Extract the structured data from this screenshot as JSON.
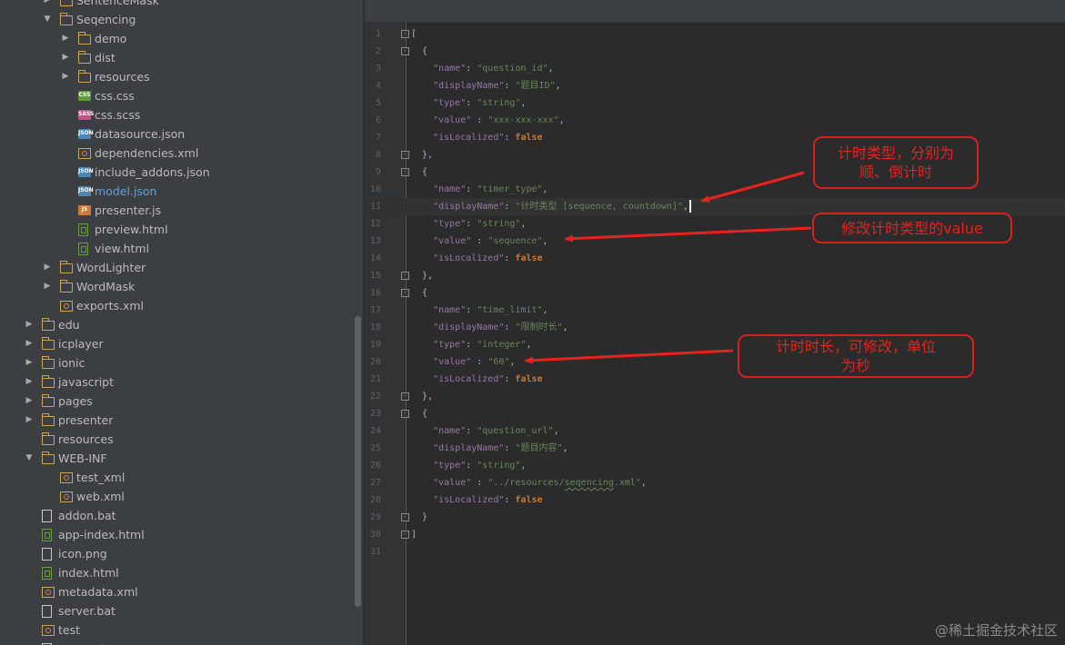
{
  "project_tree": {
    "items": [
      {
        "depth": 2,
        "expand": "right",
        "icon": "folder",
        "label": "SentenceMask"
      },
      {
        "depth": 2,
        "expand": "down",
        "icon": "folder",
        "label": "Seqencing"
      },
      {
        "depth": 3,
        "expand": "right",
        "icon": "folder",
        "label": "demo"
      },
      {
        "depth": 3,
        "expand": "right",
        "icon": "folder",
        "label": "dist"
      },
      {
        "depth": 3,
        "expand": "right",
        "icon": "folder",
        "label": "resources"
      },
      {
        "depth": 3,
        "expand": "none",
        "icon": "css",
        "label": "css.css"
      },
      {
        "depth": 3,
        "expand": "none",
        "icon": "scss",
        "label": "css.scss"
      },
      {
        "depth": 3,
        "expand": "none",
        "icon": "json",
        "label": "datasource.json"
      },
      {
        "depth": 3,
        "expand": "none",
        "icon": "xml",
        "label": "dependencies.xml"
      },
      {
        "depth": 3,
        "expand": "none",
        "icon": "json",
        "label": "include_addons.json"
      },
      {
        "depth": 3,
        "expand": "none",
        "icon": "json",
        "label": "model.json",
        "selected": true
      },
      {
        "depth": 3,
        "expand": "none",
        "icon": "js",
        "label": "presenter.js"
      },
      {
        "depth": 3,
        "expand": "none",
        "icon": "html",
        "label": "preview.html"
      },
      {
        "depth": 3,
        "expand": "none",
        "icon": "html",
        "label": "view.html"
      },
      {
        "depth": 2,
        "expand": "right",
        "icon": "folder",
        "label": "WordLighter"
      },
      {
        "depth": 2,
        "expand": "right",
        "icon": "folder",
        "label": "WordMask"
      },
      {
        "depth": 2,
        "expand": "none",
        "icon": "xml",
        "label": "exports.xml"
      },
      {
        "depth": 1,
        "expand": "right",
        "icon": "folder",
        "label": "edu"
      },
      {
        "depth": 1,
        "expand": "right",
        "icon": "folder",
        "label": "icplayer"
      },
      {
        "depth": 1,
        "expand": "right",
        "icon": "folder",
        "label": "ionic"
      },
      {
        "depth": 1,
        "expand": "right",
        "icon": "folder",
        "label": "javascript"
      },
      {
        "depth": 1,
        "expand": "right",
        "icon": "folder",
        "label": "pages"
      },
      {
        "depth": 1,
        "expand": "right",
        "icon": "folder",
        "label": "presenter"
      },
      {
        "depth": 1,
        "expand": "none",
        "icon": "folder",
        "label": "resources"
      },
      {
        "depth": 1,
        "expand": "down",
        "icon": "folder",
        "label": "WEB-INF"
      },
      {
        "depth": 2,
        "expand": "none",
        "icon": "xml",
        "label": "test_xml"
      },
      {
        "depth": 2,
        "expand": "none",
        "icon": "xml",
        "label": "web.xml"
      },
      {
        "depth": 1,
        "expand": "none",
        "icon": "file",
        "label": "addon.bat"
      },
      {
        "depth": 1,
        "expand": "none",
        "icon": "html",
        "label": "app-index.html"
      },
      {
        "depth": 1,
        "expand": "none",
        "icon": "file",
        "label": "icon.png"
      },
      {
        "depth": 1,
        "expand": "none",
        "icon": "html",
        "label": "index.html"
      },
      {
        "depth": 1,
        "expand": "none",
        "icon": "xml",
        "label": "metadata.xml"
      },
      {
        "depth": 1,
        "expand": "none",
        "icon": "file",
        "label": "server.bat"
      },
      {
        "depth": 1,
        "expand": "none",
        "icon": "xml",
        "label": "test"
      },
      {
        "depth": 1,
        "expand": "none",
        "icon": "file",
        "label": "test.xml"
      }
    ]
  },
  "editor": {
    "current_line": 11,
    "lines": [
      {
        "n": "1",
        "fold": "-",
        "tokens": [
          [
            "p",
            "["
          ]
        ]
      },
      {
        "n": "2",
        "fold": "-",
        "tokens": [
          [
            "p",
            "  {"
          ]
        ]
      },
      {
        "n": "3",
        "tokens": [
          [
            "p",
            "    "
          ],
          [
            "k",
            "\"name\""
          ],
          [
            "p",
            ": "
          ],
          [
            "s",
            "\"question_id\""
          ],
          [
            "p",
            ","
          ]
        ]
      },
      {
        "n": "4",
        "tokens": [
          [
            "p",
            "    "
          ],
          [
            "k",
            "\"displayName\""
          ],
          [
            "p",
            ": "
          ],
          [
            "s",
            "\"题目ID\""
          ],
          [
            "p",
            ","
          ]
        ]
      },
      {
        "n": "5",
        "tokens": [
          [
            "p",
            "    "
          ],
          [
            "k",
            "\"type\""
          ],
          [
            "p",
            ": "
          ],
          [
            "s",
            "\"string\""
          ],
          [
            "p",
            ","
          ]
        ]
      },
      {
        "n": "6",
        "tokens": [
          [
            "p",
            "    "
          ],
          [
            "k",
            "\"value\""
          ],
          [
            "p",
            " : "
          ],
          [
            "s",
            "\"xxx-xxx-xxx\""
          ],
          [
            "p",
            ","
          ]
        ]
      },
      {
        "n": "7",
        "tokens": [
          [
            "p",
            "    "
          ],
          [
            "k",
            "\"isLocalized\""
          ],
          [
            "p",
            ": "
          ],
          [
            "b",
            "false"
          ]
        ]
      },
      {
        "n": "8",
        "fold": "-",
        "tokens": [
          [
            "p",
            "  },"
          ]
        ]
      },
      {
        "n": "9",
        "fold": "-",
        "tokens": [
          [
            "p",
            "  {"
          ]
        ]
      },
      {
        "n": "10",
        "tokens": [
          [
            "p",
            "    "
          ],
          [
            "k",
            "\"name\""
          ],
          [
            "p",
            ": "
          ],
          [
            "s",
            "\"timer_type\""
          ],
          [
            "p",
            ","
          ]
        ]
      },
      {
        "n": "11",
        "tokens": [
          [
            "p",
            "    "
          ],
          [
            "k",
            "\"displayName\""
          ],
          [
            "p",
            ": "
          ],
          [
            "s",
            "\"计时类型 [sequence, countdown]\""
          ],
          [
            "p",
            ","
          ]
        ],
        "caret": true
      },
      {
        "n": "12",
        "tokens": [
          [
            "p",
            "    "
          ],
          [
            "k",
            "\"type\""
          ],
          [
            "p",
            ": "
          ],
          [
            "s",
            "\"string\""
          ],
          [
            "p",
            ","
          ]
        ]
      },
      {
        "n": "13",
        "tokens": [
          [
            "p",
            "    "
          ],
          [
            "k",
            "\"value\""
          ],
          [
            "p",
            " : "
          ],
          [
            "s",
            "\"sequence\""
          ],
          [
            "p",
            ","
          ]
        ]
      },
      {
        "n": "14",
        "tokens": [
          [
            "p",
            "    "
          ],
          [
            "k",
            "\"isLocalized\""
          ],
          [
            "p",
            ": "
          ],
          [
            "b",
            "false"
          ]
        ]
      },
      {
        "n": "15",
        "fold": "-",
        "tokens": [
          [
            "p",
            "  },"
          ]
        ]
      },
      {
        "n": "16",
        "fold": "-",
        "tokens": [
          [
            "p",
            "  {"
          ]
        ]
      },
      {
        "n": "17",
        "tokens": [
          [
            "p",
            "    "
          ],
          [
            "k",
            "\"name\""
          ],
          [
            "p",
            ": "
          ],
          [
            "s",
            "\"time_limit\""
          ],
          [
            "p",
            ","
          ]
        ]
      },
      {
        "n": "18",
        "tokens": [
          [
            "p",
            "    "
          ],
          [
            "k",
            "\"displayName\""
          ],
          [
            "p",
            ": "
          ],
          [
            "s",
            "\"限制时长\""
          ],
          [
            "p",
            ","
          ]
        ]
      },
      {
        "n": "19",
        "tokens": [
          [
            "p",
            "    "
          ],
          [
            "k",
            "\"type\""
          ],
          [
            "p",
            ": "
          ],
          [
            "s",
            "\"integer\""
          ],
          [
            "p",
            ","
          ]
        ]
      },
      {
        "n": "20",
        "tokens": [
          [
            "p",
            "    "
          ],
          [
            "k",
            "\"value\""
          ],
          [
            "p",
            " : "
          ],
          [
            "s",
            "\"60\""
          ],
          [
            "p",
            ","
          ]
        ]
      },
      {
        "n": "21",
        "tokens": [
          [
            "p",
            "    "
          ],
          [
            "k",
            "\"isLocalized\""
          ],
          [
            "p",
            ": "
          ],
          [
            "b",
            "false"
          ]
        ]
      },
      {
        "n": "22",
        "fold": "-",
        "tokens": [
          [
            "p",
            "  },"
          ]
        ]
      },
      {
        "n": "23",
        "fold": "-",
        "tokens": [
          [
            "p",
            "  {"
          ]
        ]
      },
      {
        "n": "24",
        "tokens": [
          [
            "p",
            "    "
          ],
          [
            "k",
            "\"name\""
          ],
          [
            "p",
            ": "
          ],
          [
            "s",
            "\"question_url\""
          ],
          [
            "p",
            ","
          ]
        ]
      },
      {
        "n": "25",
        "tokens": [
          [
            "p",
            "    "
          ],
          [
            "k",
            "\"displayName\""
          ],
          [
            "p",
            ": "
          ],
          [
            "s",
            "\"题目内容\""
          ],
          [
            "p",
            ","
          ]
        ]
      },
      {
        "n": "26",
        "tokens": [
          [
            "p",
            "    "
          ],
          [
            "k",
            "\"type\""
          ],
          [
            "p",
            ": "
          ],
          [
            "s",
            "\"string\""
          ],
          [
            "p",
            ","
          ]
        ]
      },
      {
        "n": "27",
        "tokens": [
          [
            "p",
            "    "
          ],
          [
            "k",
            "\"value\""
          ],
          [
            "p",
            " : "
          ],
          [
            "s",
            "\"../resources/"
          ],
          [
            "sq",
            "seqencing"
          ],
          [
            "s",
            ".xml\""
          ],
          [
            "p",
            ","
          ]
        ]
      },
      {
        "n": "28",
        "tokens": [
          [
            "p",
            "    "
          ],
          [
            "k",
            "\"isLocalized\""
          ],
          [
            "p",
            ": "
          ],
          [
            "b",
            "false"
          ]
        ]
      },
      {
        "n": "29",
        "fold": "-",
        "tokens": [
          [
            "p",
            "  }"
          ]
        ]
      },
      {
        "n": "30",
        "fold": "-",
        "tokens": [
          [
            "p",
            "]"
          ]
        ]
      },
      {
        "n": "31",
        "tokens": []
      }
    ]
  },
  "annotations": {
    "timer_type_note": "计时类型，分别为顺、倒计时",
    "timer_type_note_line1": "计时类型，分别为",
    "timer_type_note_line2": "顺、倒计时",
    "value_note": "修改计时类型的value",
    "time_limit_note_line1": "计时时长，可修改，单位",
    "time_limit_note_line2": "为秒"
  },
  "watermark": "@稀土掘金技术社区",
  "colors": {
    "tree_bg": "#3c3f41",
    "editor_bg": "#2b2b2b",
    "json_key": "#9876aa",
    "json_string": "#6a8759",
    "json_bool": "#cc7832",
    "annotation_red": "#e8211e",
    "selected_item": "#6a9fd8",
    "folder_icon": "#c9a45a"
  }
}
